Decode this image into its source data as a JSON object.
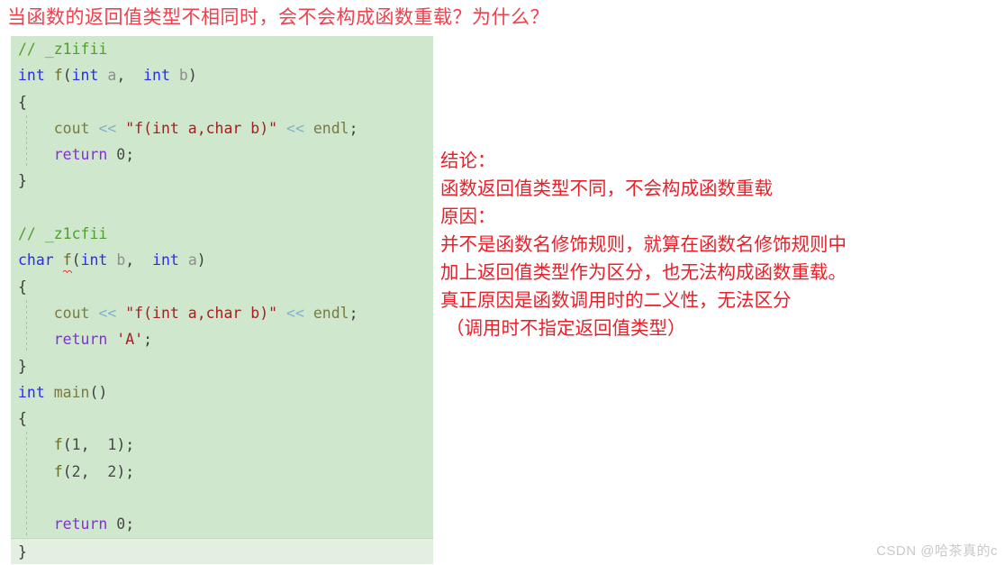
{
  "title": "当函数的返回值类型不相同时，会不会构成函数重载？为什么？",
  "code": {
    "language": "C++",
    "lines": [
      {
        "indent_guide": false,
        "current": false,
        "tokens": [
          {
            "t": "// _z1ifii",
            "c": "cmt"
          }
        ]
      },
      {
        "indent_guide": false,
        "current": false,
        "tokens": [
          {
            "t": "int",
            "c": "kw"
          },
          {
            "t": " ",
            "c": "punct"
          },
          {
            "t": "f",
            "c": "fn"
          },
          {
            "t": "(",
            "c": "punct"
          },
          {
            "t": "int",
            "c": "kw"
          },
          {
            "t": " ",
            "c": "punct"
          },
          {
            "t": "a",
            "c": "var"
          },
          {
            "t": ",  ",
            "c": "punct"
          },
          {
            "t": "int",
            "c": "kw"
          },
          {
            "t": " ",
            "c": "punct"
          },
          {
            "t": "b",
            "c": "var"
          },
          {
            "t": ")",
            "c": "punct"
          }
        ]
      },
      {
        "indent_guide": false,
        "current": false,
        "tokens": [
          {
            "t": "{",
            "c": "brace"
          }
        ]
      },
      {
        "indent_guide": true,
        "current": false,
        "tokens": [
          {
            "t": "    cout ",
            "c": "id"
          },
          {
            "t": "<< ",
            "c": "op"
          },
          {
            "t": "\"f(int a,char b)\"",
            "c": "str"
          },
          {
            "t": " << ",
            "c": "op"
          },
          {
            "t": "endl",
            "c": "id"
          },
          {
            "t": ";",
            "c": "punct"
          }
        ]
      },
      {
        "indent_guide": true,
        "current": false,
        "tokens": [
          {
            "t": "    ",
            "c": "punct"
          },
          {
            "t": "return",
            "c": "kw2"
          },
          {
            "t": " ",
            "c": "punct"
          },
          {
            "t": "0",
            "c": "num"
          },
          {
            "t": ";",
            "c": "punct"
          }
        ]
      },
      {
        "indent_guide": false,
        "current": false,
        "tokens": [
          {
            "t": "}",
            "c": "brace"
          }
        ]
      },
      {
        "indent_guide": false,
        "current": false,
        "tokens": []
      },
      {
        "indent_guide": false,
        "current": false,
        "tokens": [
          {
            "t": "// _z1cfii",
            "c": "cmt"
          }
        ]
      },
      {
        "indent_guide": false,
        "current": false,
        "squiggle_token": 2,
        "tokens": [
          {
            "t": "char",
            "c": "kw"
          },
          {
            "t": " ",
            "c": "punct"
          },
          {
            "t": "f",
            "c": "fn"
          },
          {
            "t": "(",
            "c": "punct"
          },
          {
            "t": "int",
            "c": "kw"
          },
          {
            "t": " ",
            "c": "punct"
          },
          {
            "t": "b",
            "c": "var"
          },
          {
            "t": ",  ",
            "c": "punct"
          },
          {
            "t": "int",
            "c": "kw"
          },
          {
            "t": " ",
            "c": "punct"
          },
          {
            "t": "a",
            "c": "var"
          },
          {
            "t": ")",
            "c": "punct"
          }
        ]
      },
      {
        "indent_guide": false,
        "current": false,
        "tokens": [
          {
            "t": "{",
            "c": "brace"
          }
        ]
      },
      {
        "indent_guide": true,
        "current": false,
        "tokens": [
          {
            "t": "    cout ",
            "c": "id"
          },
          {
            "t": "<< ",
            "c": "op"
          },
          {
            "t": "\"f(int a,char b)\"",
            "c": "str"
          },
          {
            "t": " << ",
            "c": "op"
          },
          {
            "t": "endl",
            "c": "id"
          },
          {
            "t": ";",
            "c": "punct"
          }
        ]
      },
      {
        "indent_guide": true,
        "current": false,
        "tokens": [
          {
            "t": "    ",
            "c": "punct"
          },
          {
            "t": "return",
            "c": "kw2"
          },
          {
            "t": " ",
            "c": "punct"
          },
          {
            "t": "'A'",
            "c": "str"
          },
          {
            "t": ";",
            "c": "punct"
          }
        ]
      },
      {
        "indent_guide": false,
        "current": false,
        "tokens": [
          {
            "t": "}",
            "c": "brace"
          }
        ]
      },
      {
        "indent_guide": false,
        "current": false,
        "tokens": [
          {
            "t": "int",
            "c": "kw"
          },
          {
            "t": " ",
            "c": "punct"
          },
          {
            "t": "main",
            "c": "id"
          },
          {
            "t": "()",
            "c": "punct"
          }
        ]
      },
      {
        "indent_guide": false,
        "current": false,
        "tokens": [
          {
            "t": "{",
            "c": "brace"
          }
        ]
      },
      {
        "indent_guide": true,
        "current": false,
        "tokens": [
          {
            "t": "    ",
            "c": "punct"
          },
          {
            "t": "f",
            "c": "fn"
          },
          {
            "t": "(",
            "c": "punct"
          },
          {
            "t": "1",
            "c": "num"
          },
          {
            "t": ",  ",
            "c": "punct"
          },
          {
            "t": "1",
            "c": "num"
          },
          {
            "t": ");",
            "c": "punct"
          }
        ]
      },
      {
        "indent_guide": true,
        "current": false,
        "tokens": [
          {
            "t": "    ",
            "c": "punct"
          },
          {
            "t": "f",
            "c": "fn"
          },
          {
            "t": "(",
            "c": "punct"
          },
          {
            "t": "2",
            "c": "num"
          },
          {
            "t": ",  ",
            "c": "punct"
          },
          {
            "t": "2",
            "c": "num"
          },
          {
            "t": ");",
            "c": "punct"
          }
        ]
      },
      {
        "indent_guide": true,
        "current": false,
        "tokens": []
      },
      {
        "indent_guide": true,
        "current": false,
        "tokens": [
          {
            "t": "    ",
            "c": "punct"
          },
          {
            "t": "return",
            "c": "kw2"
          },
          {
            "t": " ",
            "c": "punct"
          },
          {
            "t": "0",
            "c": "num"
          },
          {
            "t": ";",
            "c": "punct"
          }
        ]
      },
      {
        "indent_guide": false,
        "current": true,
        "tokens": [
          {
            "t": "}",
            "c": "brace"
          }
        ]
      }
    ]
  },
  "annotation": {
    "lines": [
      {
        "text": "结论：",
        "indent": false
      },
      {
        "text": "函数返回值类型不同，不会构成函数重载",
        "indent": false
      },
      {
        "text": "原因：",
        "indent": false
      },
      {
        "text": "并不是函数名修饰规则，就算在函数名修饰规则中",
        "indent": false
      },
      {
        "text": "加上返回值类型作为区分，也无法构成函数重载。",
        "indent": false
      },
      {
        "text": "真正原因是函数调用时的二义性，无法区分",
        "indent": false
      },
      {
        "text": "（调用时不指定返回值类型）",
        "indent": true
      }
    ]
  },
  "watermark": "CSDN @哈茶真的c",
  "colors": {
    "title": "#f0404c",
    "annotation": "#e8202a",
    "code_background": "#cfe7cd",
    "code_current_line": "#e2efe1",
    "comment": "#4f9f2f",
    "keyword": "#2c2cf0",
    "keyword_control": "#8a2be2",
    "string": "#a52020",
    "operator": "#86b0c9",
    "variable": "#8f8f8f",
    "function": "#6b6b2a",
    "error_squiggle": "#e02020",
    "watermark": "#c9c9c9"
  }
}
